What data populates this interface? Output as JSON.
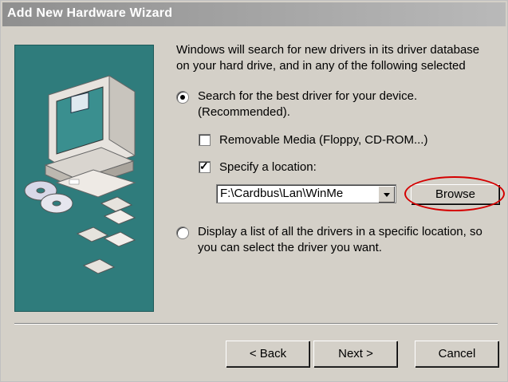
{
  "window": {
    "title": "Add New Hardware Wizard"
  },
  "intro_text": "Windows will search for new drivers in its driver database on your hard drive, and in any of the following selected",
  "options": {
    "search_best": {
      "label": "Search for the best driver for your device. (Recommended).",
      "checked": true
    },
    "removable_media": {
      "label": "Removable Media (Floppy, CD-ROM...)",
      "checked": false
    },
    "specify_location": {
      "label": "Specify a location:",
      "checked": true
    },
    "location_value": "F:\\Cardbus\\Lan\\WinMe",
    "browse_label": "Browse",
    "display_list": {
      "label": "Display a list of all the drivers in a specific location, so you can select the driver you want.",
      "checked": false
    }
  },
  "buttons": {
    "back": "< Back",
    "next": "Next >",
    "cancel": "Cancel"
  },
  "colors": {
    "title_gradient_start": "#8f8f8f",
    "panel_teal": "#2f7c7c",
    "highlight_ellipse": "#d40000"
  },
  "icons": [
    "computer-icon",
    "cd-icon",
    "floppy-disk-icon"
  ]
}
